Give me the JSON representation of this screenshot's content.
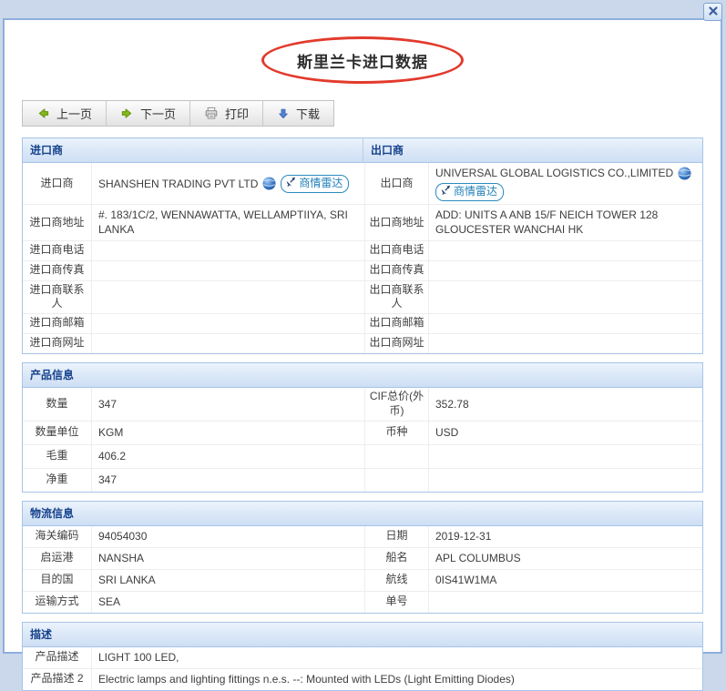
{
  "window": {
    "close_icon": "close-x"
  },
  "title": "斯里兰卡进口数据",
  "toolbar": {
    "prev_label": "上一页",
    "next_label": "下一页",
    "print_label": "打印",
    "download_label": "下载",
    "icons": {
      "prev": "green-arrow-left",
      "next": "green-arrow-right",
      "print": "printer",
      "download": "blue-arrow-down"
    }
  },
  "colors": {
    "page_background": "#CBD8EB",
    "panel_border": "#8EAFDC",
    "section_border": "#A6C4E8",
    "section_header_text": "#15428B",
    "cell_border": "#EDEDED",
    "body_text": "#3D3D3D",
    "badge_blue": "#1E7FB8",
    "annotation_red": "#E23A2C"
  },
  "parties": {
    "importer_header": "进口商",
    "exporter_header": "出口商",
    "importer": {
      "name_label": "进口商",
      "name": "SHANSHEN TRADING PVT LTD",
      "radar_badge": "商情雷达",
      "address_label": "进口商地址",
      "address": "#. 183/1C/2, WENNAWATTA, WELLAMPTIIYA, SRI LANKA",
      "phone_label": "进口商电话",
      "phone": "",
      "fax_label": "进口商传真",
      "fax": "",
      "contact_label": "进口商联系人",
      "contact": "",
      "email_label": "进口商邮箱",
      "email": "",
      "website_label": "进口商网址",
      "website": ""
    },
    "exporter": {
      "name_label": "出口商",
      "name": "UNIVERSAL GLOBAL LOGISTICS CO.,LIMITED",
      "radar_badge": "商情雷达",
      "address_label": "出口商地址",
      "address": "ADD: UNITS A ANB 15/F NEICH TOWER 128 GLOUCESTER WANCHAI HK",
      "phone_label": "出口商电话",
      "phone": "",
      "fax_label": "出口商传真",
      "fax": "",
      "contact_label": "出口商联系人",
      "contact": "",
      "email_label": "出口商邮箱",
      "email": "",
      "website_label": "出口商网址",
      "website": ""
    }
  },
  "product": {
    "header": "产品信息",
    "rows": [
      {
        "l": "数量",
        "lv": "347",
        "r": "CIF总价(外币)",
        "rv": "352.78"
      },
      {
        "l": "数量单位",
        "lv": "KGM",
        "r": "币种",
        "rv": "USD"
      },
      {
        "l": "毛重",
        "lv": "406.2",
        "r": "",
        "rv": ""
      },
      {
        "l": "净重",
        "lv": "347",
        "r": "",
        "rv": ""
      }
    ]
  },
  "logistics": {
    "header": "物流信息",
    "rows": [
      {
        "l": "海关编码",
        "lv": "94054030",
        "r": "日期",
        "rv": "2019-12-31"
      },
      {
        "l": "启运港",
        "lv": "NANSHA",
        "r": "船名",
        "rv": "APL COLUMBUS"
      },
      {
        "l": "目的国",
        "lv": "SRI LANKA",
        "r": "航线",
        "rv": "0IS41W1MA"
      },
      {
        "l": "运输方式",
        "lv": "SEA",
        "r": "单号",
        "rv": ""
      }
    ]
  },
  "description": {
    "header": "描述",
    "rows": [
      {
        "l": "产品描述",
        "v": "LIGHT 100 LED,"
      },
      {
        "l": "产品描述 2",
        "v": "Electric lamps and lighting fittings n.e.s. --: Mounted with LEDs (Light Emitting Diodes)"
      }
    ]
  }
}
